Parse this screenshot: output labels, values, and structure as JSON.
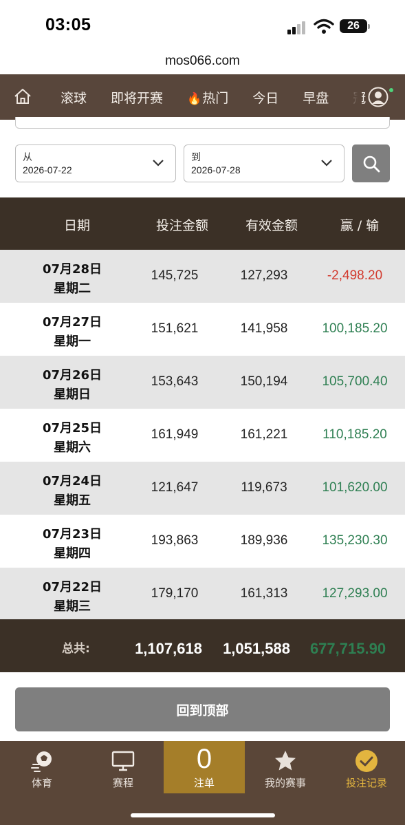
{
  "status": {
    "time": "03:05",
    "battery": "26"
  },
  "browser": {
    "url": "mos066.com"
  },
  "nav": {
    "items": [
      {
        "label": "滚球"
      },
      {
        "label": "即将开赛"
      },
      {
        "label": "热门",
        "icon": "flame-icon"
      },
      {
        "label": "今日"
      },
      {
        "label": "早盘"
      },
      {
        "label": "冠"
      }
    ]
  },
  "filter": {
    "from_label": "从",
    "from_value": "2026-07-22",
    "to_label": "到",
    "to_value": "2026-07-28"
  },
  "table": {
    "headers": [
      "日期",
      "投注金额",
      "有效金额",
      "赢 / 输"
    ],
    "rows": [
      {
        "date": "07月28日",
        "weekday": "星期二",
        "bet": "145,725",
        "valid": "127,293",
        "winloss": "-2,498.20",
        "positive": false
      },
      {
        "date": "07月27日",
        "weekday": "星期一",
        "bet": "151,621",
        "valid": "141,958",
        "winloss": "100,185.20",
        "positive": true
      },
      {
        "date": "07月26日",
        "weekday": "星期日",
        "bet": "153,643",
        "valid": "150,194",
        "winloss": "105,700.40",
        "positive": true
      },
      {
        "date": "07月25日",
        "weekday": "星期六",
        "bet": "161,949",
        "valid": "161,221",
        "winloss": "110,185.20",
        "positive": true
      },
      {
        "date": "07月24日",
        "weekday": "星期五",
        "bet": "121,647",
        "valid": "119,673",
        "winloss": "101,620.00",
        "positive": true
      },
      {
        "date": "07月23日",
        "weekday": "星期四",
        "bet": "193,863",
        "valid": "189,936",
        "winloss": "135,230.30",
        "positive": true
      },
      {
        "date": "07月22日",
        "weekday": "星期三",
        "bet": "179,170",
        "valid": "161,313",
        "winloss": "127,293.00",
        "positive": true
      }
    ],
    "total": {
      "label": "总共:",
      "bet": "1,107,618",
      "valid": "1,051,588",
      "winloss": "677,715.90"
    }
  },
  "back_to_top": "回到顶部",
  "tabbar": {
    "items": [
      {
        "label": "体育",
        "icon": "soccer-ball-icon"
      },
      {
        "label": "赛程",
        "icon": "monitor-icon"
      },
      {
        "label": "注单",
        "count": "0"
      },
      {
        "label": "我的赛事",
        "icon": "star-icon"
      },
      {
        "label": "投注记录",
        "icon": "check-circle-icon"
      }
    ]
  },
  "colors": {
    "nav_bg": "#58463b",
    "table_head_bg": "#3b3026",
    "positive": "#2e7f52",
    "negative": "#d23a2e",
    "accent_gold": "#a57e29",
    "selected_tab": "#e3b53f"
  }
}
